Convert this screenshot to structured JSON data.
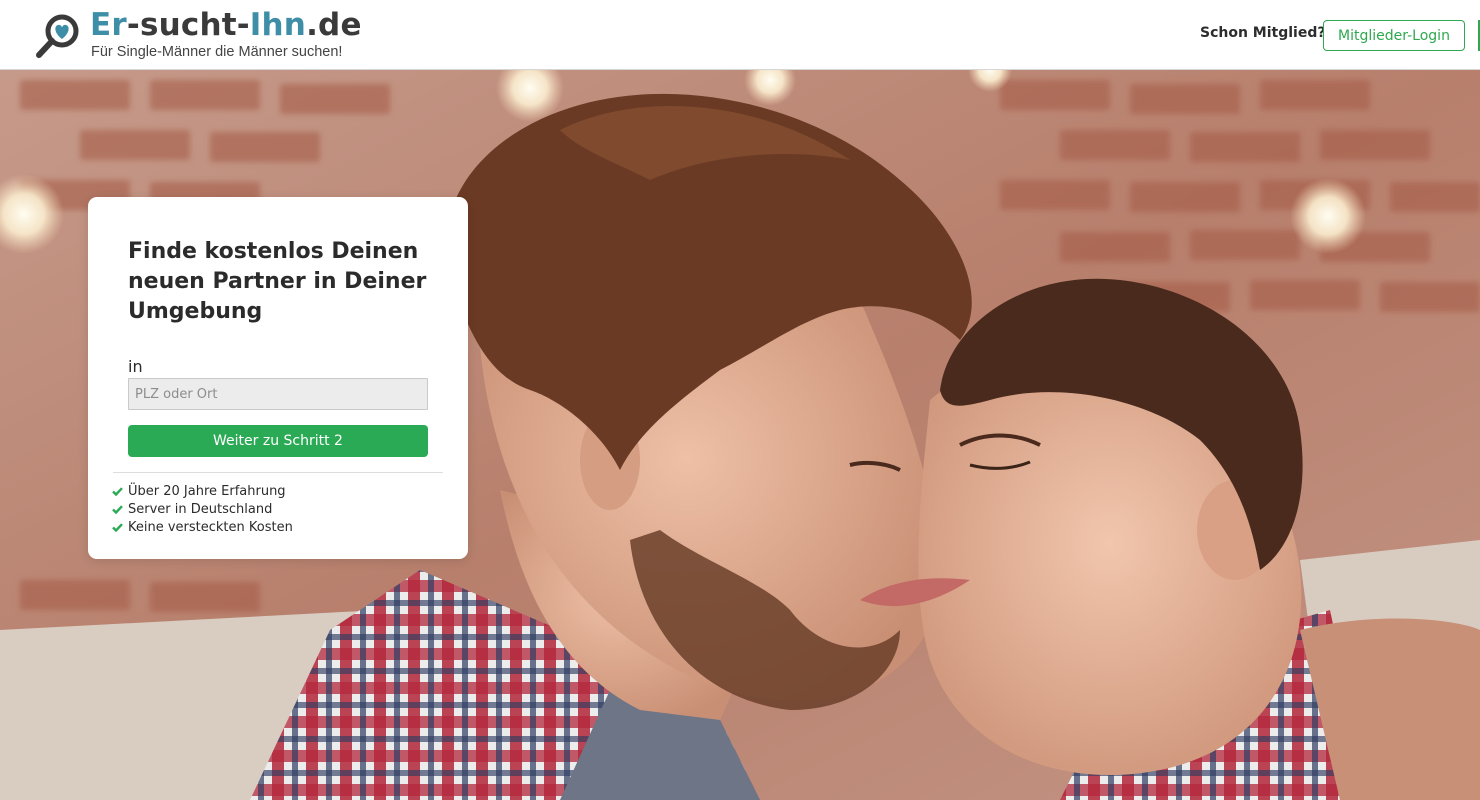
{
  "header": {
    "logo": {
      "title_part1": "Er",
      "title_part2": "-sucht-",
      "title_part3": "Ihn",
      "title_part4": ".de",
      "tagline": "Für Single-Männer die Männer suchen!",
      "icon": "magnifier-heart-icon"
    },
    "member_question": "Schon Mitglied?",
    "login_button": "Mitglieder-Login"
  },
  "hero": {
    "image": "hero-photo-two-men"
  },
  "signup_card": {
    "title": "Finde kostenlos Deinen neuen Partner in Deiner Umgebung",
    "location_label": "in",
    "location_placeholder": "PLZ oder Ort",
    "location_value": "",
    "next_button": "Weiter zu Schritt 2",
    "features": [
      {
        "icon": "check-icon",
        "text": "Über 20 Jahre Erfahrung"
      },
      {
        "icon": "check-icon",
        "text": "Server in Deutschland"
      },
      {
        "icon": "check-icon",
        "text": "Keine versteckten Kosten"
      }
    ]
  },
  "colors": {
    "brand_teal": "#3e8ea7",
    "brand_dark": "#3a3a3a",
    "accent_green": "#2baa55",
    "login_green": "#2fa84f"
  }
}
